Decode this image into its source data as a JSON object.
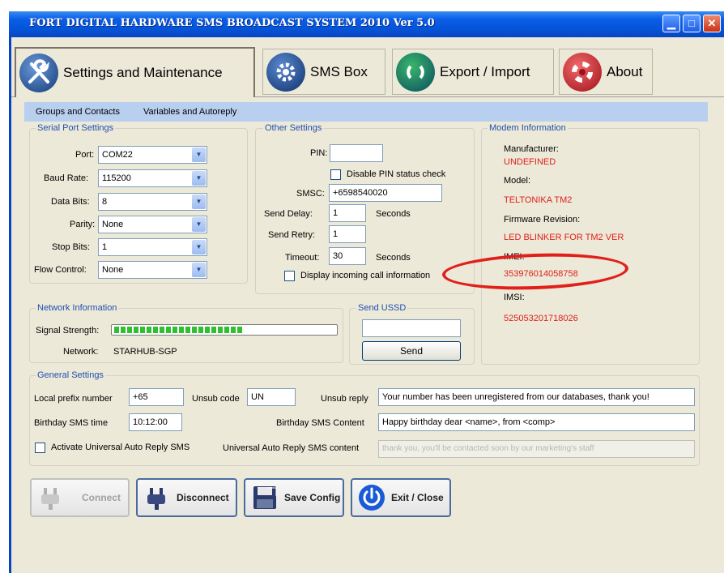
{
  "window": {
    "title": "FORT DIGITAL HARDWARE SMS BROADCAST SYSTEM 2010 Ver 5.0",
    "controls": {
      "minimize": "▁",
      "maximize": "□",
      "close": "✕"
    }
  },
  "tabs": [
    {
      "label": "Settings and Maintenance",
      "icon": "wrench-icon",
      "active": true
    },
    {
      "label": "SMS Box",
      "icon": "gear-icon",
      "active": false
    },
    {
      "label": "Export / Import",
      "icon": "sync-icon",
      "active": false
    },
    {
      "label": "About",
      "icon": "lifebuoy-icon",
      "active": false
    }
  ],
  "submenu": [
    "Groups and Contacts",
    "Variables and Autoreply"
  ],
  "serial_port": {
    "title": "Serial Port Settings",
    "fields": [
      {
        "label": "Port:",
        "value": "COM22"
      },
      {
        "label": "Baud Rate:",
        "value": "115200"
      },
      {
        "label": "Data Bits:",
        "value": "8"
      },
      {
        "label": "Parity:",
        "value": "None"
      },
      {
        "label": "Stop Bits:",
        "value": "1"
      },
      {
        "label": "Flow Control:",
        "value": "None"
      }
    ]
  },
  "other_settings": {
    "title": "Other Settings",
    "pin_label": "PIN:",
    "pin_value": "",
    "disable_pin_label": "Disable PIN status check",
    "smsc_label": "SMSC:",
    "smsc_value": "+6598540020",
    "send_delay_label": "Send Delay:",
    "send_delay_value": "1",
    "send_retry_label": "Send Retry:",
    "send_retry_value": "1",
    "timeout_label": "Timeout:",
    "timeout_value": "30",
    "seconds_label": "Seconds",
    "display_incoming_label": "Display incoming call information"
  },
  "modem_info": {
    "title": "Modem Information",
    "manufacturer_label": "Manufacturer:",
    "manufacturer_value": "UNDEFINED",
    "model_label": "Model:",
    "model_value": "TELTONIKA TM2",
    "firmware_label": "Firmware Revision:",
    "firmware_value": "LED BLINKER FOR TM2 VER",
    "imei_label": "IMEI:",
    "imei_value": "353976014058758",
    "imsi_label": "IMSI:",
    "imsi_value": "525053201718026"
  },
  "network": {
    "title": "Network Information",
    "signal_label": "Signal Strength:",
    "signal_level": 0.58,
    "network_label": "Network:",
    "network_value": "STARHUB-SGP"
  },
  "send_ussd": {
    "title": "Send USSD",
    "value": "",
    "send_label": "Send"
  },
  "general": {
    "title": "General Settings",
    "local_prefix_label": "Local prefix number",
    "local_prefix_value": "+65",
    "unsub_code_label": "Unsub code",
    "unsub_code_value": "UN",
    "unsub_reply_label": "Unsub reply",
    "unsub_reply_value": "Your number has been unregistered from our databases, thank you!",
    "birthday_time_label": "Birthday SMS time",
    "birthday_time_value": "10:12:00",
    "birthday_content_label": "Birthday SMS Content",
    "birthday_content_value": "Happy birthday dear <name>, from <comp>",
    "activate_auto_label": "Activate Universal Auto Reply SMS",
    "auto_content_label": "Universal Auto Reply SMS content",
    "auto_content_value": "thank you, you'll be contacted soon by our marketing's staff"
  },
  "actions": {
    "connect": "Connect",
    "disconnect": "Disconnect",
    "save_config": "Save Config",
    "exit_close": "Exit / Close"
  },
  "colors": {
    "title_blue": "#0553d6",
    "modem_red": "#e0201a",
    "group_title_blue": "#1f4fb0"
  }
}
